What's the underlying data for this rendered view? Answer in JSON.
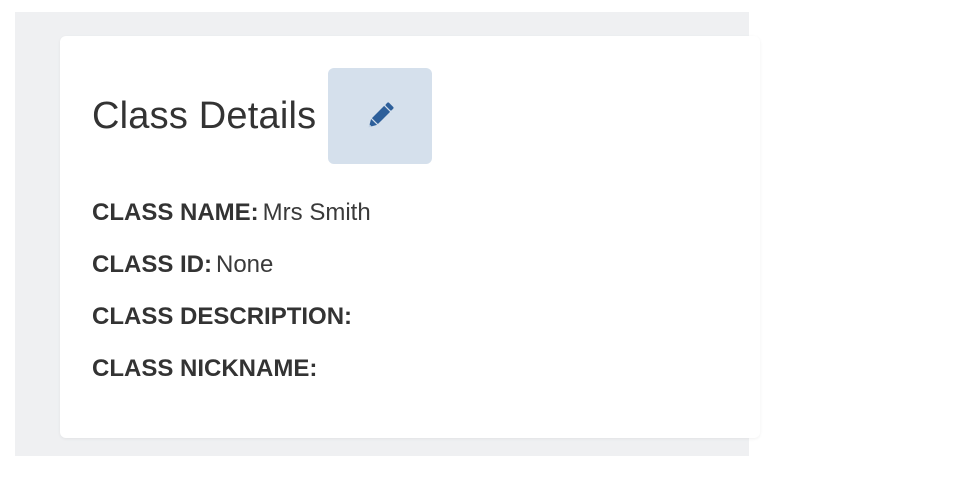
{
  "card": {
    "title": "Class Details",
    "edit_icon": "pencil-icon"
  },
  "details": [
    {
      "label": "CLASS NAME:",
      "value": "Mrs Smith"
    },
    {
      "label": "CLASS ID:",
      "value": "None"
    },
    {
      "label": "CLASS DESCRIPTION:",
      "value": ""
    },
    {
      "label": "CLASS NICKNAME:",
      "value": ""
    }
  ],
  "colors": {
    "background": "#eff0f2",
    "card": "#ffffff",
    "edit_button_bg": "#d5e0ec",
    "edit_icon": "#2d5f9a",
    "text": "#333333"
  }
}
